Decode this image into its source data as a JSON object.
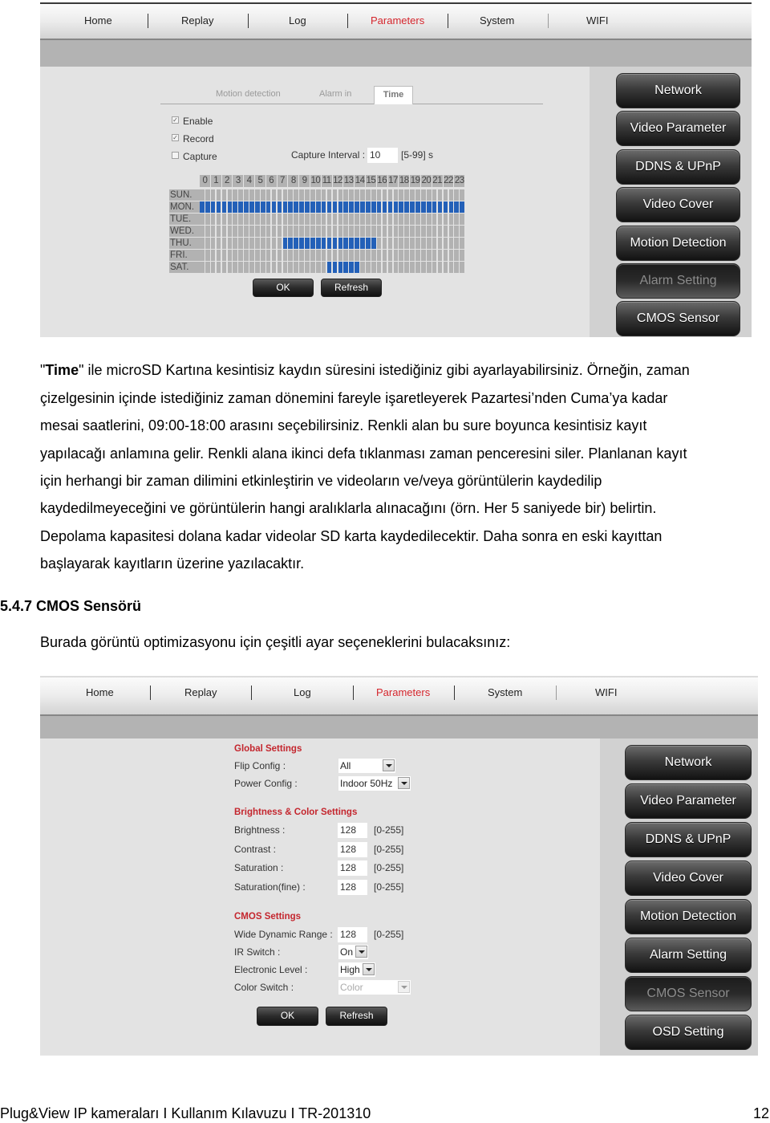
{
  "panel1": {
    "nav": [
      {
        "label": "Home",
        "active": false
      },
      {
        "label": "Replay",
        "active": false
      },
      {
        "label": "Log",
        "active": false
      },
      {
        "label": "Parameters",
        "active": true
      },
      {
        "label": "System",
        "active": false
      },
      {
        "label": "WIFI",
        "active": false
      }
    ],
    "tabs": [
      {
        "label": "Motion detection",
        "active": false
      },
      {
        "label": "Alarm in",
        "active": false
      },
      {
        "label": "Time",
        "active": true
      }
    ],
    "checkboxes": [
      {
        "label": "Enable",
        "checked": true
      },
      {
        "label": "Record",
        "checked": true
      },
      {
        "label": "Capture",
        "checked": false
      }
    ],
    "capture_interval": {
      "label": "Capture Interval :",
      "value": "10",
      "range": "[5-99] s"
    },
    "schedule": {
      "hours": [
        "0",
        "1",
        "2",
        "3",
        "4",
        "5",
        "6",
        "7",
        "8",
        "9",
        "10",
        "11",
        "12",
        "13",
        "14",
        "15",
        "16",
        "17",
        "18",
        "19",
        "20",
        "21",
        "22",
        "23"
      ],
      "days": [
        {
          "label": "SUN.",
          "selected_hours": []
        },
        {
          "label": "MON.",
          "selected_hours": [
            [
              0,
              24
            ]
          ]
        },
        {
          "label": "TUE.",
          "selected_hours": []
        },
        {
          "label": "WED.",
          "selected_hours": []
        },
        {
          "label": "THU.",
          "selected_hours": [
            [
              7.5,
              16
            ]
          ]
        },
        {
          "label": "FRI.",
          "selected_hours": []
        },
        {
          "label": "SAT.",
          "selected_hours": [
            [
              11.5,
              14.5
            ]
          ]
        }
      ],
      "slots_per_hour": 2,
      "selected_color": "#2360b8",
      "empty_color": "#b2b2b2"
    },
    "buttons": {
      "ok": "OK",
      "refresh": "Refresh"
    },
    "sidebar": [
      {
        "label": "Network",
        "disabled": false
      },
      {
        "label": "Video Parameter",
        "disabled": false
      },
      {
        "label": "DDNS & UPnP",
        "disabled": false
      },
      {
        "label": "Video Cover",
        "disabled": false
      },
      {
        "label": "Motion Detection",
        "disabled": false
      },
      {
        "label": "Alarm Setting",
        "disabled": true
      },
      {
        "label": "CMOS Sensor",
        "disabled": false
      }
    ]
  },
  "doc": {
    "line0_prefix": "\"",
    "line0_bold": "Time",
    "line0_rest": "\" ile microSD Kartına kesintisiz kaydın süresini istediğiniz gibi ayarlayabilirsiniz. Örneğin, zaman",
    "lines": [
      "çizelgesinin içinde istediğiniz zaman dönemini fareyle işaretleyerek Pazartesi’nden Cuma’ya kadar",
      "mesai saatlerini, 09:00-18:00 arasını seçebilirsiniz. Renkli alan bu sure boyunca kesintisiz kayıt",
      "yapılacağı anlamına gelir. Renkli alana ikinci defa tıklanması zaman penceresini siler. Planlanan kayıt",
      "için herhangi bir zaman dilimini etkinleştirin ve videoların ve/veya görüntülerin kaydedilip",
      "kaydedilmeyeceğini ve görüntülerin hangi aralıklarla alınacağını (örn. Her 5 saniyede bir) belirtin.",
      "Depolama kapasitesi dolana kadar videolar SD karta kaydedilecektir. Daha sonra en eski kayıttan",
      "başlayarak kayıtların üzerine yazılacaktır."
    ],
    "section_heading": "5.4.7 CMOS Sensörü",
    "section_intro": "Burada görüntü optimizasyonu için çeşitli ayar seçeneklerini bulacaksınız:"
  },
  "panel2": {
    "nav": [
      {
        "label": "Home",
        "active": false
      },
      {
        "label": "Replay",
        "active": false
      },
      {
        "label": "Log",
        "active": false
      },
      {
        "label": "Parameters",
        "active": true
      },
      {
        "label": "System",
        "active": false
      },
      {
        "label": "WIFI",
        "active": false
      }
    ],
    "global": {
      "title": "Global Settings",
      "flip_label": "Flip Config :",
      "flip_value": "All",
      "power_label": "Power Config :",
      "power_value": "Indoor 50Hz"
    },
    "brightness": {
      "title": "Brightness & Color Settings",
      "fields": [
        {
          "label": "Brightness :",
          "value": "128",
          "range": "[0-255]"
        },
        {
          "label": "Contrast :",
          "value": "128",
          "range": "[0-255]"
        },
        {
          "label": "Saturation :",
          "value": "128",
          "range": "[0-255]"
        },
        {
          "label": "Saturation(fine) :",
          "value": "128",
          "range": "[0-255]"
        }
      ]
    },
    "cmos": {
      "title": "CMOS Settings",
      "wdr_label": "Wide Dynamic Range :",
      "wdr_value": "128",
      "wdr_range": "[0-255]",
      "ir_label": "IR Switch :",
      "ir_value": "On",
      "level_label": "Electronic Level :",
      "level_value": "High",
      "color_label": "Color Switch :",
      "color_value": "Color"
    },
    "buttons": {
      "ok": "OK",
      "refresh": "Refresh"
    },
    "sidebar": [
      {
        "label": "Network",
        "disabled": false
      },
      {
        "label": "Video Parameter",
        "disabled": false
      },
      {
        "label": "DDNS & UPnP",
        "disabled": false
      },
      {
        "label": "Video Cover",
        "disabled": false
      },
      {
        "label": "Motion Detection",
        "disabled": false
      },
      {
        "label": "Alarm Setting",
        "disabled": false
      },
      {
        "label": "CMOS Sensor",
        "disabled": true
      },
      {
        "label": "OSD Setting",
        "disabled": false
      }
    ]
  },
  "footer": {
    "left": "Plug&View IP kameraları I Kullanım Kılavuzu I TR-201310",
    "page_number": "12"
  },
  "colors": {
    "accent_red": "#d5262d",
    "section_red": "#c4262e"
  }
}
